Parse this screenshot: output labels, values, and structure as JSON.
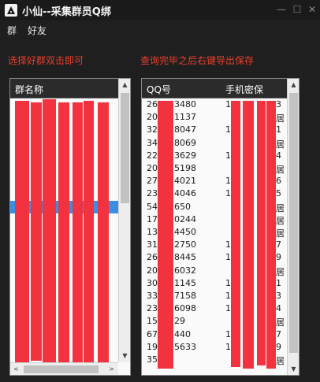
{
  "window": {
    "title": "小仙--采集群员Q绑",
    "icon": "app-logo-icon",
    "min_glyph": "—",
    "max_glyph": "☐",
    "close_glyph": "✕"
  },
  "menu": {
    "group": "群",
    "friend": "好友"
  },
  "hints": {
    "left": "选择好群双击即可",
    "right": "查询完毕之后右键导出保存"
  },
  "groups": {
    "header": "群名称",
    "rows": [
      "",
      "",
      "",
      "",
      "",
      "",
      "",
      "",
      "",
      "",
      "",
      "",
      "",
      "",
      "",
      "",
      "",
      "",
      "",
      "",
      ""
    ],
    "selected_index": 8
  },
  "members": {
    "headers": {
      "qq": "QQ号",
      "phone": "手机密保"
    },
    "rows": [
      {
        "qq_head": "26",
        "qq_tail": "3480",
        "phone_head": "1",
        "phone_tail": "3"
      },
      {
        "qq_head": "20",
        "qq_tail": "1137",
        "phone_head": "",
        "phone_tail": "居"
      },
      {
        "qq_head": "32",
        "qq_tail": "8047",
        "phone_head": "1",
        "phone_tail": "1"
      },
      {
        "qq_head": "34",
        "qq_tail": "8069",
        "phone_head": "",
        "phone_tail": "居"
      },
      {
        "qq_head": "22",
        "qq_tail": "3629",
        "phone_head": "1",
        "phone_tail": "4"
      },
      {
        "qq_head": "20",
        "qq_tail": "5198",
        "phone_head": "",
        "phone_tail": "居"
      },
      {
        "qq_head": "27",
        "qq_tail": "4021",
        "phone_head": "1",
        "phone_tail": "6"
      },
      {
        "qq_head": "23",
        "qq_tail": "4046",
        "phone_head": "1",
        "phone_tail": "5"
      },
      {
        "qq_head": "54",
        "qq_tail": "650",
        "phone_head": "",
        "phone_tail": "居"
      },
      {
        "qq_head": "17",
        "qq_tail": "0244",
        "phone_head": "",
        "phone_tail": "居"
      },
      {
        "qq_head": "13",
        "qq_tail": "4450",
        "phone_head": "",
        "phone_tail": "居"
      },
      {
        "qq_head": "31",
        "qq_tail": "2750",
        "phone_head": "1",
        "phone_tail": "7"
      },
      {
        "qq_head": "26",
        "qq_tail": "8445",
        "phone_head": "1",
        "phone_tail": "9"
      },
      {
        "qq_head": "20",
        "qq_tail": "6032",
        "phone_head": "",
        "phone_tail": "居"
      },
      {
        "qq_head": "30",
        "qq_tail": "1145",
        "phone_head": "1",
        "phone_tail": "1"
      },
      {
        "qq_head": "33",
        "qq_tail": "7158",
        "phone_head": "1",
        "phone_tail": "3"
      },
      {
        "qq_head": "23",
        "qq_tail": "6098",
        "phone_head": "1",
        "phone_tail": "4"
      },
      {
        "qq_head": "15",
        "qq_tail": "29",
        "phone_head": "",
        "phone_tail": "居"
      },
      {
        "qq_head": "67",
        "qq_tail": "440",
        "phone_head": "1",
        "phone_tail": "7"
      },
      {
        "qq_head": "19",
        "qq_tail": "5633",
        "phone_head": "1",
        "phone_tail": "9"
      },
      {
        "qq_head": "35",
        "qq_tail": "",
        "phone_head": "",
        "phone_tail": "居"
      }
    ]
  },
  "scroll": {
    "up_glyph": "▲",
    "down_glyph": "▼",
    "left_glyph": "<",
    "right_glyph": ">"
  },
  "colors": {
    "background": "#1f1f1f",
    "hint_text": "#e8402c",
    "redaction": "#f2333f",
    "selection": "#3b8ee0"
  }
}
